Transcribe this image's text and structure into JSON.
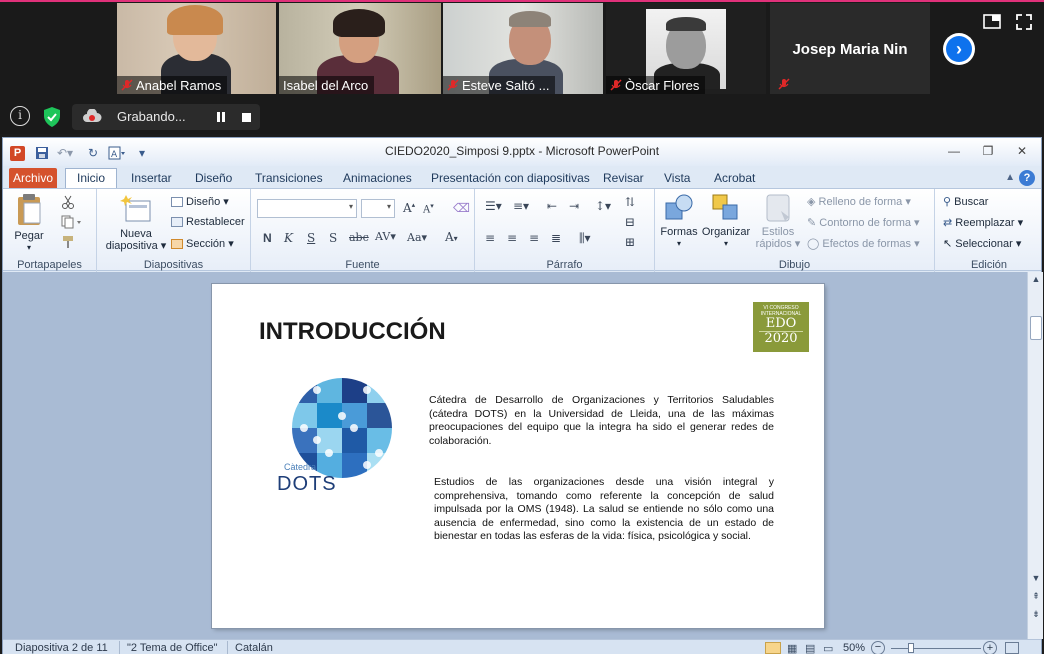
{
  "zoom": {
    "participants": [
      {
        "name": "Anabel Ramos",
        "muted": true
      },
      {
        "name": "Isabel del Arco",
        "muted": false,
        "active": true
      },
      {
        "name": "Esteve Saltó ...",
        "muted": true
      },
      {
        "name": "Òscar Flores",
        "muted": true
      }
    ],
    "name_only_tile": {
      "name": "Josep Maria Nin",
      "muted": true
    },
    "next_icon": "chevron-right-icon",
    "recording_label": "Grabando...",
    "accent_colors": {
      "active_border": "#9bd36b",
      "top_line": "#e0317a",
      "next_button": "#0e72ed",
      "shield": "#1ec55a"
    }
  },
  "window": {
    "title": "CIEDO2020_Simposi 9.pptx - Microsoft PowerPoint",
    "controls": [
      "minimize",
      "restore",
      "close"
    ]
  },
  "ribbon": {
    "tabs": [
      "Archivo",
      "Inicio",
      "Insertar",
      "Diseño",
      "Transiciones",
      "Animaciones",
      "Presentación con diapositivas",
      "Revisar",
      "Vista",
      "Acrobat"
    ],
    "selected_tab": "Inicio",
    "groups": {
      "portapapeles": {
        "label": "Portapapeles",
        "paste": "Pegar"
      },
      "diapositivas": {
        "label": "Diapositivas",
        "new_slide_1": "Nueva",
        "new_slide_2": "diapositiva",
        "layout": "Diseño",
        "reset": "Restablecer",
        "section": "Sección"
      },
      "fuente": {
        "label": "Fuente"
      },
      "parrafo": {
        "label": "Párrafo"
      },
      "dibujo": {
        "label": "Dibujo",
        "shapes": "Formas",
        "arrange": "Organizar",
        "quick_styles_1": "Estilos",
        "quick_styles_2": "rápidos",
        "fill": "Relleno de forma",
        "outline": "Contorno de forma",
        "effects": "Efectos de formas"
      },
      "edicion": {
        "label": "Edición",
        "find": "Buscar",
        "replace": "Reemplazar",
        "select": "Seleccionar"
      }
    }
  },
  "slide": {
    "title": "INTRODUCCIÓN",
    "logo_edo": {
      "line1": "VI CONGRESO INTERNACIONAL",
      "line2": "EDO",
      "line3": "2020"
    },
    "logo_dots": {
      "line1": "Càtedra",
      "line2": "DOTS"
    },
    "paragraph1": "Cátedra de Desarrollo de Organizaciones y Territorios Saludables (cátedra DOTS) en la Universidad de Lleida, una de las máximas preocupaciones del equipo que la integra ha sido el generar redes de colaboración.",
    "paragraph2": "Estudios de las organizaciones desde una visión integral y comprehensiva, tomando como referente la concepción de salud impulsada por la OMS (1948). La salud se entiende no sólo como una ausencia de enfermedad, sino como la existencia de un estado de bienestar en todas las esferas de la vida: física, psicológica y social."
  },
  "status": {
    "slide_pos": "Diapositiva 2 de 11",
    "theme": "\"2 Tema de Office\"",
    "language": "Catalán",
    "zoom": "50%"
  }
}
